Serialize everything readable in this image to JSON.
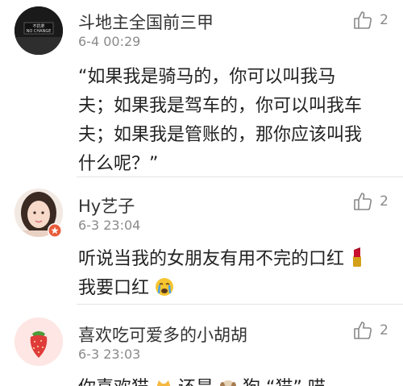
{
  "comments": [
    {
      "username": "斗地主全国前三甲",
      "time": "6-4 00:29",
      "likes": "2",
      "avatar_text": "不抗拿 NO CHANGE",
      "lines": [
        "“如果我是骑马的，你可以叫我马",
        "夫；如果我是驾车的，你可以叫我车",
        "夫；如果我是管账的，那你应该叫我",
        "什么呢？”"
      ]
    },
    {
      "username": "Hy艺子",
      "time": "6-3 23:04",
      "likes": "2",
      "lines": [
        "听说当我的女朋友有用不完的口红",
        "我要口红"
      ]
    },
    {
      "username": "喜欢吃可爱多的小胡胡",
      "time": "6-3 23:03",
      "likes": "2",
      "lines": [
        "你喜欢猫",
        "还是",
        "狗",
        "“猫”",
        "喵~"
      ]
    }
  ],
  "icons": {
    "like": "thumbs-up-icon",
    "lipstick": "lipstick-emoji",
    "crying": "crying-face-emoji",
    "cat": "cat-emoji",
    "dog": "dog-emoji"
  },
  "colors": {
    "text": "#222222",
    "meta": "#8a8a8a",
    "divider": "#e4e4e4"
  }
}
